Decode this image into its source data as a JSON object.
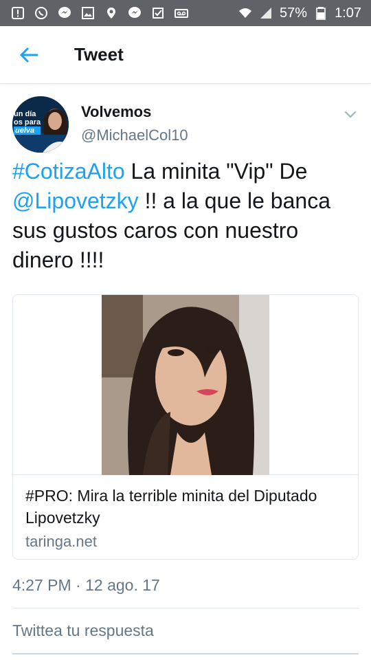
{
  "status_bar": {
    "left_icons": [
      "alert-icon",
      "whatsapp-icon",
      "messenger-icon",
      "image-icon",
      "location-icon",
      "messenger-icon",
      "check-icon",
      "voicemail-icon"
    ],
    "battery": "57%",
    "time": "1:07"
  },
  "header": {
    "title": "Tweet"
  },
  "tweet": {
    "author_name": "Volvemos",
    "author_handle": "@MichaelCol10",
    "avatar_text": [
      "un día",
      "os para",
      "uelva"
    ],
    "text_parts": {
      "hashtag": "#CotizaAlto",
      "text1": " La minita \"Vip\" De ",
      "mention": "@Lipovetzky",
      "text2": " !! a la que le banca sus gustos caros con nuestro dinero !!!!"
    },
    "card": {
      "title": "#PRO: Mira la terrible minita del Diputado Lipovetzky",
      "domain": "taringa.net"
    },
    "timestamp": "4:27 PM · 12 ago. 17"
  },
  "reply": {
    "placeholder": "Twittea tu respuesta"
  },
  "colors": {
    "status_bar": "#5f6368",
    "link": "#1da1f2",
    "secondary_text": "#657786",
    "border": "#e1e8ed"
  }
}
